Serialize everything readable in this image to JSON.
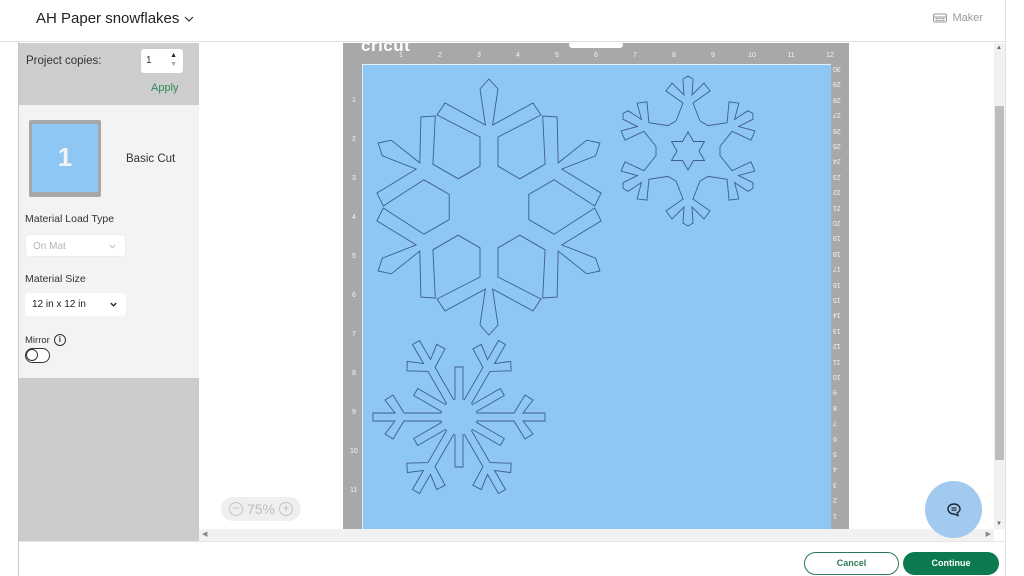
{
  "header": {
    "project_title": "AH Paper snowflakes",
    "machine_label": "Maker",
    "machine_icon": "machine-icon"
  },
  "copies": {
    "label": "Project copies:",
    "value": "1",
    "apply_label": "Apply"
  },
  "mat": {
    "number": "1",
    "name": "Basic Cut",
    "load_type_label": "Material Load Type",
    "load_type_value": "On Mat",
    "size_label": "Material Size",
    "size_value": "12 in x 12 in",
    "mirror_label": "Mirror",
    "mirror_on": false
  },
  "canvas": {
    "logo": "cricut",
    "ruler_top": [
      "1",
      "2",
      "3",
      "4",
      "5",
      "6",
      "7",
      "8",
      "9",
      "10",
      "11",
      "12"
    ],
    "ruler_left": [
      "1",
      "2",
      "3",
      "4",
      "5",
      "6",
      "7",
      "8",
      "9",
      "10",
      "11"
    ],
    "ruler_right": [
      "30",
      "29",
      "28",
      "27",
      "26",
      "25",
      "24",
      "23",
      "22",
      "21",
      "20",
      "19",
      "18",
      "17",
      "16",
      "15",
      "14",
      "13",
      "12",
      "11",
      "10",
      "9",
      "8",
      "7",
      "6",
      "5",
      "4",
      "3",
      "2",
      "1"
    ],
    "zoom_level": "75%",
    "mat_color": "#8ec6f4"
  },
  "footer": {
    "cancel_label": "Cancel",
    "continue_label": "Continue",
    "accent_color": "#0b7a4f"
  }
}
